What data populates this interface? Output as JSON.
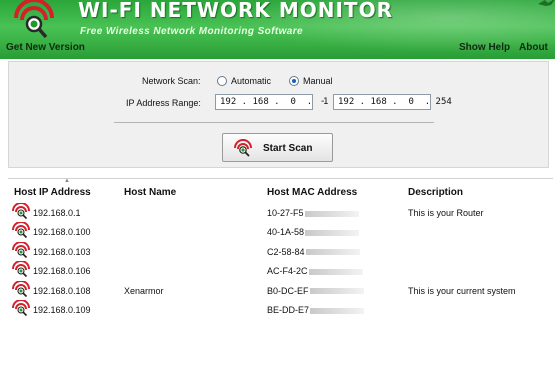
{
  "header": {
    "title": "WI-FI NETWORK MONITOR",
    "subtitle": "Free Wireless Network Monitoring Software",
    "menu_left": "Get New Version",
    "menu_help": "Show Help",
    "menu_about": "About"
  },
  "scan": {
    "network_scan_label": "Network Scan:",
    "automatic_label": "Automatic",
    "manual_label": "Manual",
    "selected_mode": "Manual",
    "ip_range_label": "IP Address Range:",
    "ip_start": "192 . 168 .  0  .  1",
    "ip_end": "192 . 168 .  0  . 254",
    "range_separator": "-",
    "start_button": "Start Scan"
  },
  "table": {
    "columns": [
      "Host IP Address",
      "Host Name",
      "Host MAC Address",
      "Description"
    ],
    "rows": [
      {
        "ip": "192.168.0.1",
        "name": "",
        "mac": "10-27-F5",
        "desc": "This is your Router"
      },
      {
        "ip": "192.168.0.100",
        "name": "",
        "mac": "40-1A-58",
        "desc": ""
      },
      {
        "ip": "192.168.0.103",
        "name": "",
        "mac": "C2-58-84",
        "desc": ""
      },
      {
        "ip": "192.168.0.106",
        "name": "",
        "mac": "AC-F4-2C",
        "desc": ""
      },
      {
        "ip": "192.168.0.108",
        "name": "Xenarmor",
        "mac": "B0-DC-EF",
        "desc": "This is your current system"
      },
      {
        "ip": "192.168.0.109",
        "name": "",
        "mac": "BE-DD-E7",
        "desc": ""
      }
    ]
  },
  "icons": {
    "logo": "wifi-magnifier-icon",
    "row_icon": "wifi-host-icon",
    "corner": "bird-icon"
  },
  "colors": {
    "header_green": "#3bb246",
    "signal_red": "#d4202a",
    "signal_green": "#1f9a2c"
  }
}
